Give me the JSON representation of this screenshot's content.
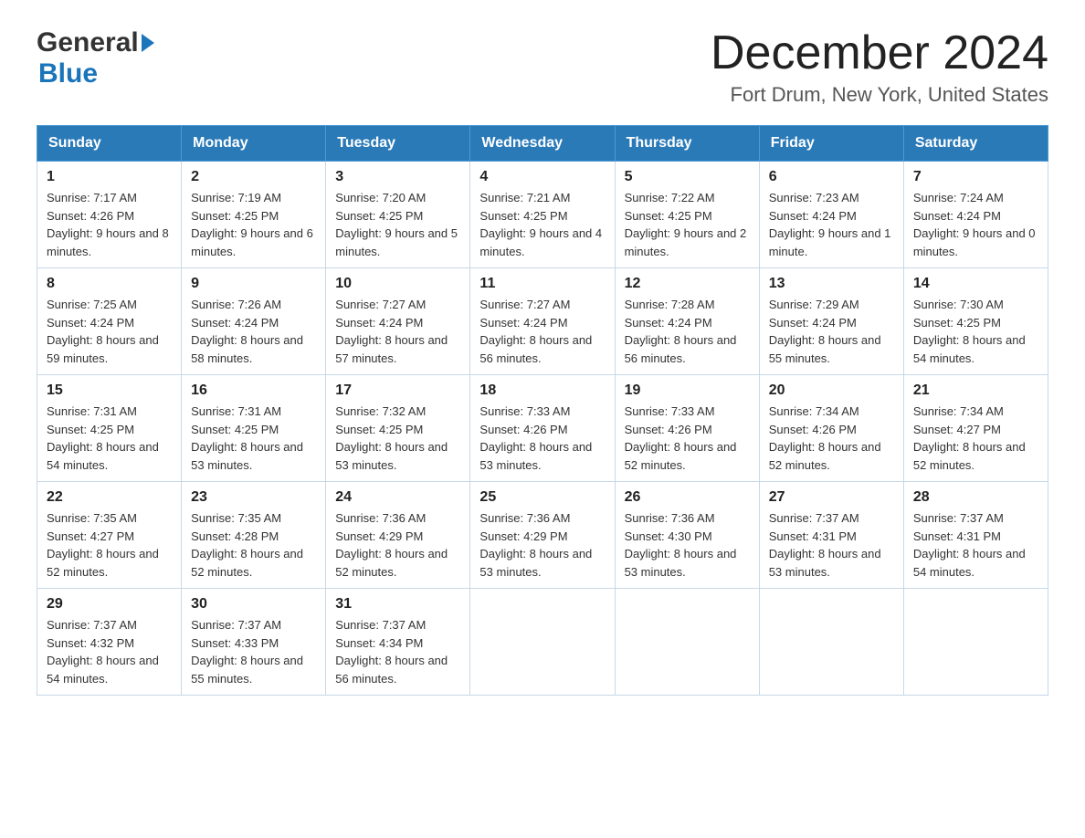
{
  "header": {
    "logo_general": "General",
    "logo_blue": "Blue",
    "month_title": "December 2024",
    "location": "Fort Drum, New York, United States"
  },
  "days_of_week": [
    "Sunday",
    "Monday",
    "Tuesday",
    "Wednesday",
    "Thursday",
    "Friday",
    "Saturday"
  ],
  "weeks": [
    [
      {
        "day": "1",
        "sunrise": "Sunrise: 7:17 AM",
        "sunset": "Sunset: 4:26 PM",
        "daylight": "Daylight: 9 hours and 8 minutes."
      },
      {
        "day": "2",
        "sunrise": "Sunrise: 7:19 AM",
        "sunset": "Sunset: 4:25 PM",
        "daylight": "Daylight: 9 hours and 6 minutes."
      },
      {
        "day": "3",
        "sunrise": "Sunrise: 7:20 AM",
        "sunset": "Sunset: 4:25 PM",
        "daylight": "Daylight: 9 hours and 5 minutes."
      },
      {
        "day": "4",
        "sunrise": "Sunrise: 7:21 AM",
        "sunset": "Sunset: 4:25 PM",
        "daylight": "Daylight: 9 hours and 4 minutes."
      },
      {
        "day": "5",
        "sunrise": "Sunrise: 7:22 AM",
        "sunset": "Sunset: 4:25 PM",
        "daylight": "Daylight: 9 hours and 2 minutes."
      },
      {
        "day": "6",
        "sunrise": "Sunrise: 7:23 AM",
        "sunset": "Sunset: 4:24 PM",
        "daylight": "Daylight: 9 hours and 1 minute."
      },
      {
        "day": "7",
        "sunrise": "Sunrise: 7:24 AM",
        "sunset": "Sunset: 4:24 PM",
        "daylight": "Daylight: 9 hours and 0 minutes."
      }
    ],
    [
      {
        "day": "8",
        "sunrise": "Sunrise: 7:25 AM",
        "sunset": "Sunset: 4:24 PM",
        "daylight": "Daylight: 8 hours and 59 minutes."
      },
      {
        "day": "9",
        "sunrise": "Sunrise: 7:26 AM",
        "sunset": "Sunset: 4:24 PM",
        "daylight": "Daylight: 8 hours and 58 minutes."
      },
      {
        "day": "10",
        "sunrise": "Sunrise: 7:27 AM",
        "sunset": "Sunset: 4:24 PM",
        "daylight": "Daylight: 8 hours and 57 minutes."
      },
      {
        "day": "11",
        "sunrise": "Sunrise: 7:27 AM",
        "sunset": "Sunset: 4:24 PM",
        "daylight": "Daylight: 8 hours and 56 minutes."
      },
      {
        "day": "12",
        "sunrise": "Sunrise: 7:28 AM",
        "sunset": "Sunset: 4:24 PM",
        "daylight": "Daylight: 8 hours and 56 minutes."
      },
      {
        "day": "13",
        "sunrise": "Sunrise: 7:29 AM",
        "sunset": "Sunset: 4:24 PM",
        "daylight": "Daylight: 8 hours and 55 minutes."
      },
      {
        "day": "14",
        "sunrise": "Sunrise: 7:30 AM",
        "sunset": "Sunset: 4:25 PM",
        "daylight": "Daylight: 8 hours and 54 minutes."
      }
    ],
    [
      {
        "day": "15",
        "sunrise": "Sunrise: 7:31 AM",
        "sunset": "Sunset: 4:25 PM",
        "daylight": "Daylight: 8 hours and 54 minutes."
      },
      {
        "day": "16",
        "sunrise": "Sunrise: 7:31 AM",
        "sunset": "Sunset: 4:25 PM",
        "daylight": "Daylight: 8 hours and 53 minutes."
      },
      {
        "day": "17",
        "sunrise": "Sunrise: 7:32 AM",
        "sunset": "Sunset: 4:25 PM",
        "daylight": "Daylight: 8 hours and 53 minutes."
      },
      {
        "day": "18",
        "sunrise": "Sunrise: 7:33 AM",
        "sunset": "Sunset: 4:26 PM",
        "daylight": "Daylight: 8 hours and 53 minutes."
      },
      {
        "day": "19",
        "sunrise": "Sunrise: 7:33 AM",
        "sunset": "Sunset: 4:26 PM",
        "daylight": "Daylight: 8 hours and 52 minutes."
      },
      {
        "day": "20",
        "sunrise": "Sunrise: 7:34 AM",
        "sunset": "Sunset: 4:26 PM",
        "daylight": "Daylight: 8 hours and 52 minutes."
      },
      {
        "day": "21",
        "sunrise": "Sunrise: 7:34 AM",
        "sunset": "Sunset: 4:27 PM",
        "daylight": "Daylight: 8 hours and 52 minutes."
      }
    ],
    [
      {
        "day": "22",
        "sunrise": "Sunrise: 7:35 AM",
        "sunset": "Sunset: 4:27 PM",
        "daylight": "Daylight: 8 hours and 52 minutes."
      },
      {
        "day": "23",
        "sunrise": "Sunrise: 7:35 AM",
        "sunset": "Sunset: 4:28 PM",
        "daylight": "Daylight: 8 hours and 52 minutes."
      },
      {
        "day": "24",
        "sunrise": "Sunrise: 7:36 AM",
        "sunset": "Sunset: 4:29 PM",
        "daylight": "Daylight: 8 hours and 52 minutes."
      },
      {
        "day": "25",
        "sunrise": "Sunrise: 7:36 AM",
        "sunset": "Sunset: 4:29 PM",
        "daylight": "Daylight: 8 hours and 53 minutes."
      },
      {
        "day": "26",
        "sunrise": "Sunrise: 7:36 AM",
        "sunset": "Sunset: 4:30 PM",
        "daylight": "Daylight: 8 hours and 53 minutes."
      },
      {
        "day": "27",
        "sunrise": "Sunrise: 7:37 AM",
        "sunset": "Sunset: 4:31 PM",
        "daylight": "Daylight: 8 hours and 53 minutes."
      },
      {
        "day": "28",
        "sunrise": "Sunrise: 7:37 AM",
        "sunset": "Sunset: 4:31 PM",
        "daylight": "Daylight: 8 hours and 54 minutes."
      }
    ],
    [
      {
        "day": "29",
        "sunrise": "Sunrise: 7:37 AM",
        "sunset": "Sunset: 4:32 PM",
        "daylight": "Daylight: 8 hours and 54 minutes."
      },
      {
        "day": "30",
        "sunrise": "Sunrise: 7:37 AM",
        "sunset": "Sunset: 4:33 PM",
        "daylight": "Daylight: 8 hours and 55 minutes."
      },
      {
        "day": "31",
        "sunrise": "Sunrise: 7:37 AM",
        "sunset": "Sunset: 4:34 PM",
        "daylight": "Daylight: 8 hours and 56 minutes."
      },
      null,
      null,
      null,
      null
    ]
  ]
}
